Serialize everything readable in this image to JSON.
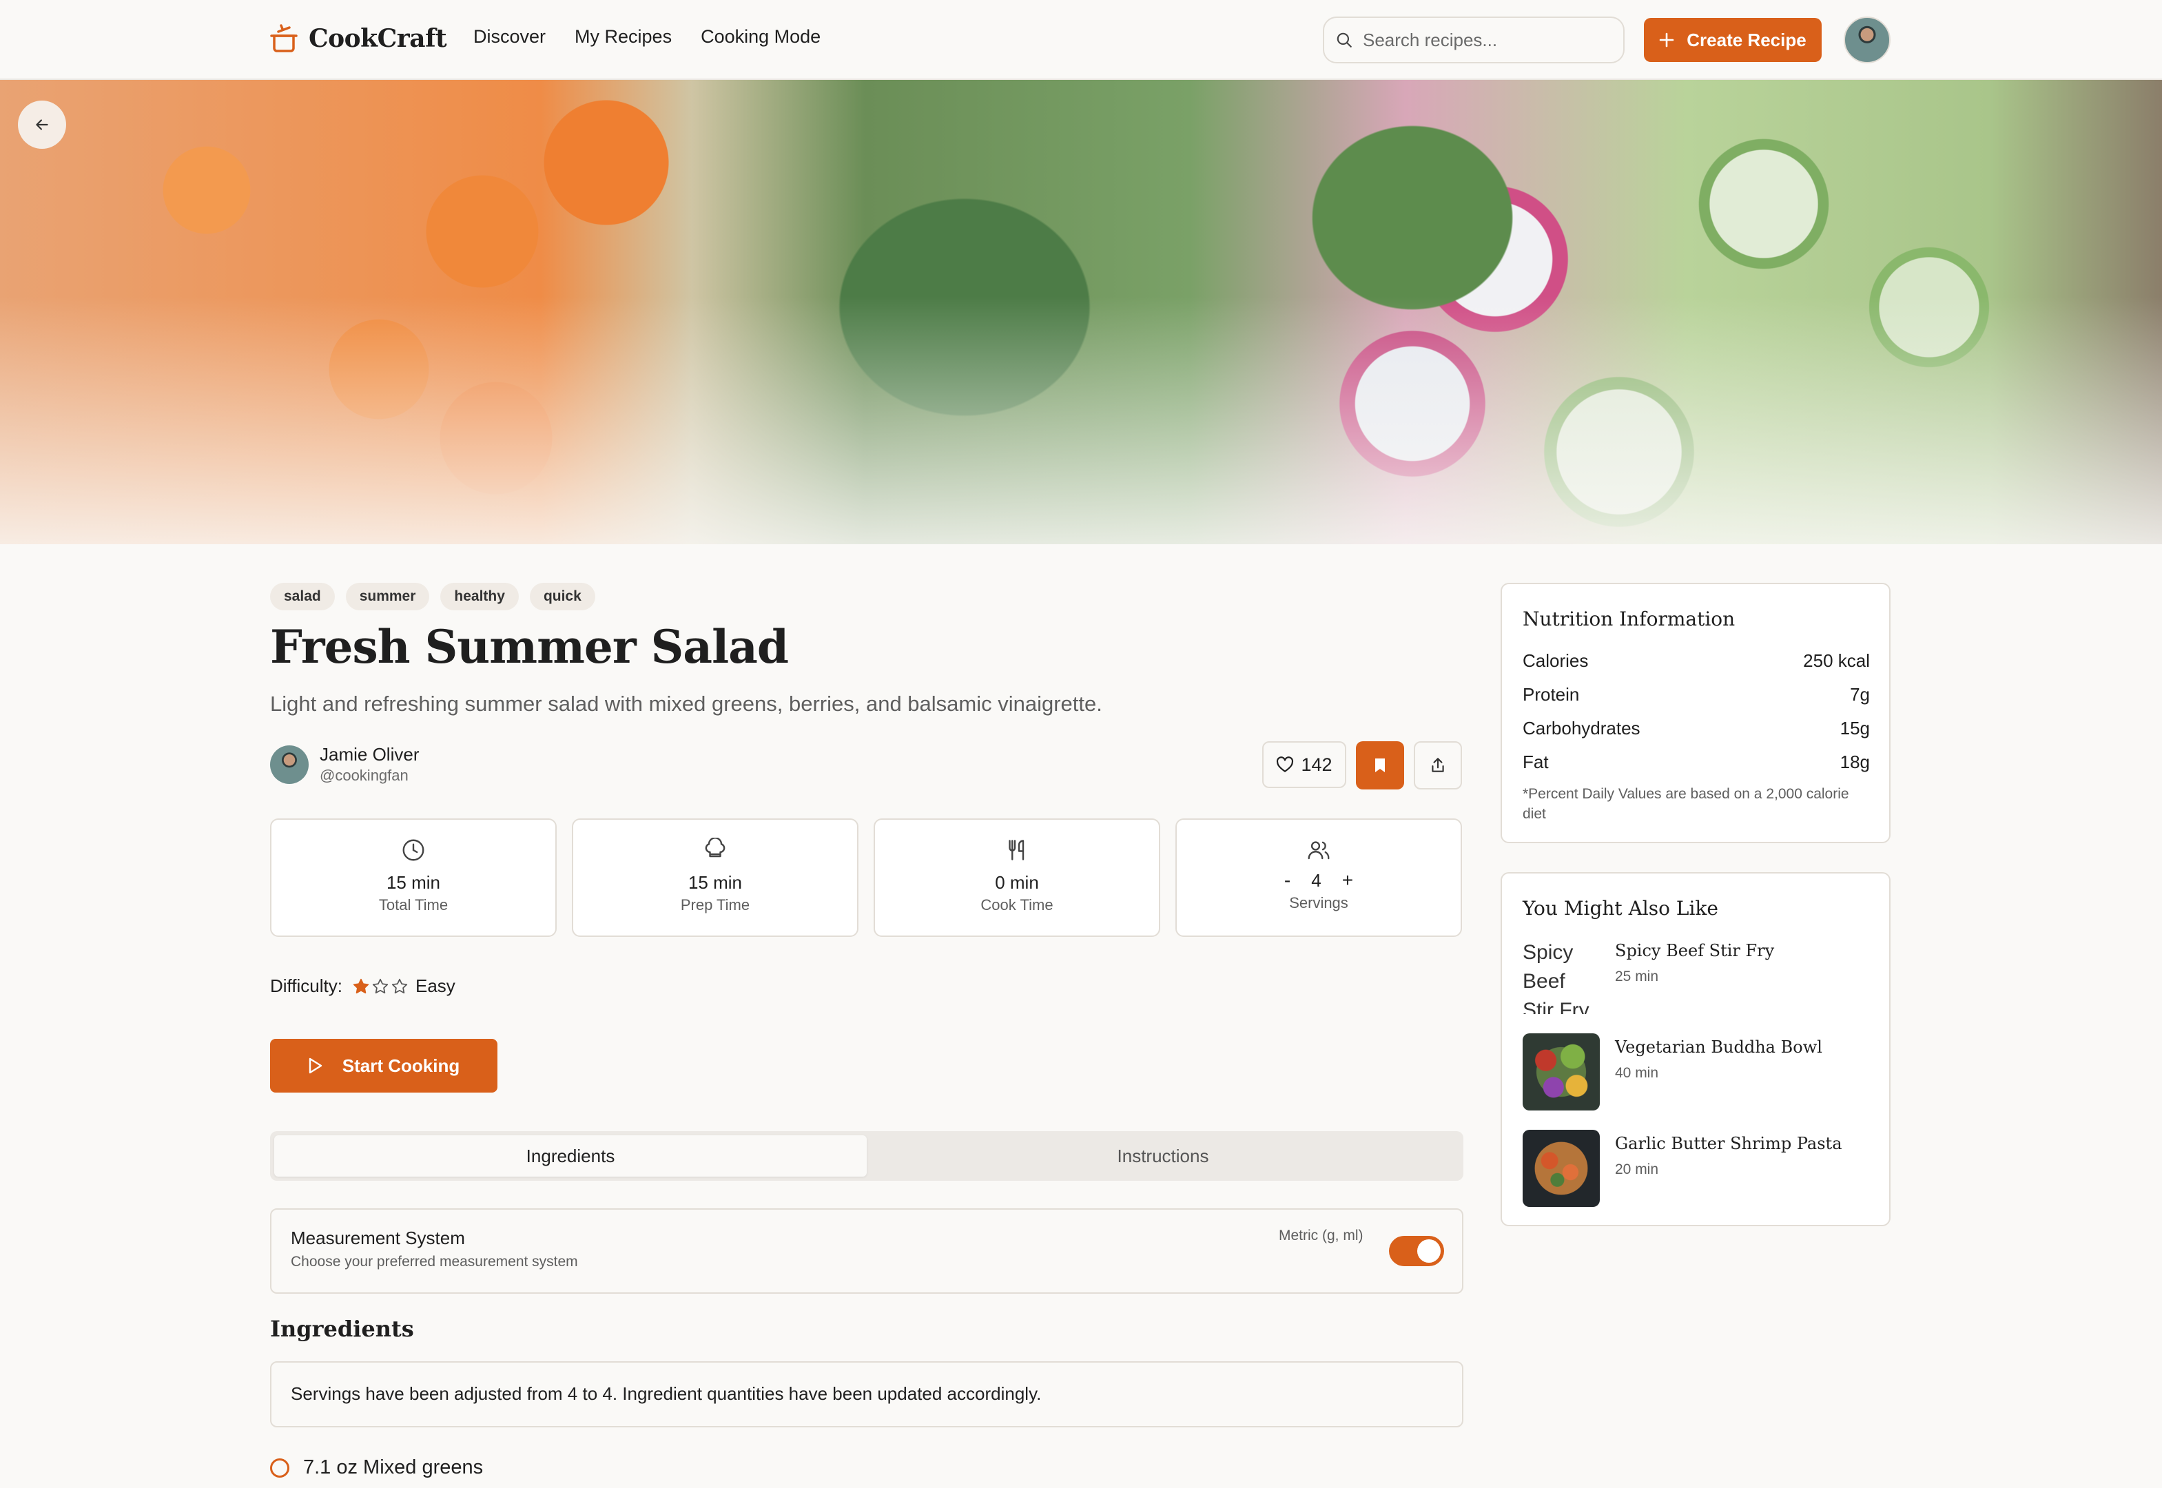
{
  "header": {
    "app_name": "CookCraft",
    "nav": [
      "Discover",
      "My Recipes",
      "Cooking Mode"
    ],
    "search_placeholder": "Search recipes...",
    "create_label": "Create Recipe"
  },
  "recipe": {
    "tags": [
      "salad",
      "summer",
      "healthy",
      "quick"
    ],
    "title": "Fresh Summer Salad",
    "description": "Light and refreshing summer salad with mixed greens, berries, and balsamic vinaigrette.",
    "author": {
      "name": "Jamie Oliver",
      "handle": "@cookingfan"
    },
    "likes": "142",
    "stats": [
      {
        "icon": "clock-icon",
        "value": "15 min",
        "label": "Total Time"
      },
      {
        "icon": "chef-hat-icon",
        "value": "15 min",
        "label": "Prep Time"
      },
      {
        "icon": "utensils-icon",
        "value": "0 min",
        "label": "Cook Time"
      }
    ],
    "servings": {
      "minus": "-",
      "value": "4",
      "plus": "+",
      "label": "Servings"
    },
    "difficulty": {
      "label": "Difficulty:",
      "value": "Easy",
      "stars_filled": 1,
      "stars_total": 3
    },
    "start_label": "Start Cooking"
  },
  "tabs": [
    {
      "label": "Ingredients",
      "active": true
    },
    {
      "label": "Instructions",
      "active": false
    }
  ],
  "measurement": {
    "title": "Measurement System",
    "subtitle": "Choose your preferred measurement system",
    "value": "Metric (g, ml)",
    "enabled": true
  },
  "ingredients": {
    "heading": "Ingredients",
    "notice": "Servings have been adjusted from 4 to 4. Ingredient quantities have been updated accordingly.",
    "items": [
      "7.1 oz Mixed greens"
    ]
  },
  "nutrition": {
    "title": "Nutrition Information",
    "rows": [
      {
        "label": "Calories",
        "value": "250 kcal"
      },
      {
        "label": "Protein",
        "value": "7g"
      },
      {
        "label": "Carbohydrates",
        "value": "15g"
      },
      {
        "label": "Fat",
        "value": "18g"
      }
    ],
    "note": "*Percent Daily Values are based on a 2,000 calorie diet"
  },
  "similar": {
    "title": "You Might Also Like",
    "items": [
      {
        "name": "Spicy Beef Stir Fry",
        "time": "25 min",
        "image_alt": "Spicy Beef Stir Fry"
      },
      {
        "name": "Vegetarian Buddha Bowl",
        "time": "40 min"
      },
      {
        "name": "Garlic Butter Shrimp Pasta",
        "time": "20 min"
      }
    ]
  },
  "colors": {
    "accent": "#d9601a",
    "background": "#faf9f7",
    "border": "#e2ddd6"
  }
}
